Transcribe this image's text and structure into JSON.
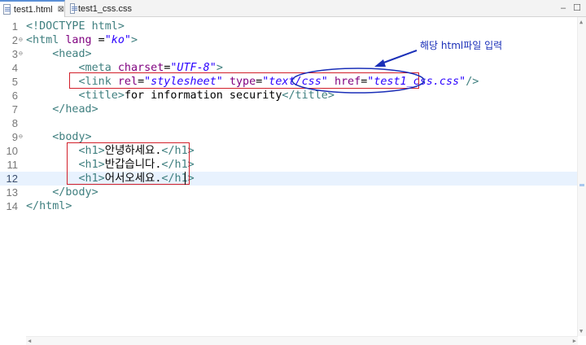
{
  "tabs": [
    {
      "label": "test1.html",
      "active": true
    },
    {
      "label": "test1_css.css",
      "active": false
    }
  ],
  "tab_close_glyph": "⊠",
  "window_controls": [
    "‒",
    "☐"
  ],
  "annotation_text": "해당 html파일 입력",
  "colors": {
    "tag": "#3f7f7f",
    "attr_name": "#7f007f",
    "attr_value": "#2a00ff",
    "annotation": "#1a2fb8",
    "highlight_box": "#d21f2a",
    "current_line": "#e8f2fe"
  },
  "editor": {
    "current_line": 12,
    "lines": [
      {
        "n": "1",
        "fold": "",
        "segments": [
          {
            "c": "t",
            "s": "<!DOCTYPE html>"
          }
        ]
      },
      {
        "n": "2",
        "fold": "⊖",
        "segments": [
          {
            "c": "t",
            "s": "<html"
          },
          {
            "c": "tx",
            "s": " "
          },
          {
            "c": "a",
            "s": "lang"
          },
          {
            "c": "tx",
            "s": " ="
          },
          {
            "c": "v",
            "s": "\"ko\""
          },
          {
            "c": "t",
            "s": ">"
          }
        ]
      },
      {
        "n": "3",
        "fold": "⊖",
        "segments": [
          {
            "c": "tx",
            "s": "    "
          },
          {
            "c": "t",
            "s": "<head>"
          }
        ]
      },
      {
        "n": "4",
        "fold": "",
        "segments": [
          {
            "c": "tx",
            "s": "        "
          },
          {
            "c": "t",
            "s": "<meta"
          },
          {
            "c": "tx",
            "s": " "
          },
          {
            "c": "a",
            "s": "charset"
          },
          {
            "c": "tx",
            "s": "="
          },
          {
            "c": "v",
            "s": "\"UTF-8\""
          },
          {
            "c": "t",
            "s": ">"
          }
        ]
      },
      {
        "n": "5",
        "fold": "",
        "segments": [
          {
            "c": "tx",
            "s": "        "
          },
          {
            "c": "t",
            "s": "<link"
          },
          {
            "c": "tx",
            "s": " "
          },
          {
            "c": "a",
            "s": "rel"
          },
          {
            "c": "tx",
            "s": "="
          },
          {
            "c": "v",
            "s": "\"stylesheet\""
          },
          {
            "c": "tx",
            "s": " "
          },
          {
            "c": "a",
            "s": "type"
          },
          {
            "c": "tx",
            "s": "="
          },
          {
            "c": "v",
            "s": "\"text/css\""
          },
          {
            "c": "tx",
            "s": " "
          },
          {
            "c": "a",
            "s": "href"
          },
          {
            "c": "tx",
            "s": "="
          },
          {
            "c": "v",
            "s": "\"test1_css.css\""
          },
          {
            "c": "t",
            "s": "/>"
          }
        ]
      },
      {
        "n": "6",
        "fold": "",
        "segments": [
          {
            "c": "tx",
            "s": "        "
          },
          {
            "c": "t",
            "s": "<title>"
          },
          {
            "c": "tx",
            "s": "for information security"
          },
          {
            "c": "t",
            "s": "</title>"
          }
        ]
      },
      {
        "n": "7",
        "fold": "",
        "segments": [
          {
            "c": "tx",
            "s": "    "
          },
          {
            "c": "t",
            "s": "</head>"
          }
        ]
      },
      {
        "n": "8",
        "fold": "",
        "segments": []
      },
      {
        "n": "9",
        "fold": "⊖",
        "segments": [
          {
            "c": "tx",
            "s": "    "
          },
          {
            "c": "t",
            "s": "<body>"
          }
        ]
      },
      {
        "n": "10",
        "fold": "",
        "segments": [
          {
            "c": "tx",
            "s": "        "
          },
          {
            "c": "t",
            "s": "<h1>"
          },
          {
            "c": "tx",
            "s": "안녕하세요."
          },
          {
            "c": "t",
            "s": "</h1>"
          }
        ]
      },
      {
        "n": "11",
        "fold": "",
        "segments": [
          {
            "c": "tx",
            "s": "        "
          },
          {
            "c": "t",
            "s": "<h1>"
          },
          {
            "c": "tx",
            "s": "반갑습니다."
          },
          {
            "c": "t",
            "s": "</h1>"
          }
        ]
      },
      {
        "n": "12",
        "fold": "",
        "segments": [
          {
            "c": "tx",
            "s": "        "
          },
          {
            "c": "t",
            "s": "<h1>"
          },
          {
            "c": "tx",
            "s": "어서오세요."
          },
          {
            "c": "t",
            "s": "</h1>"
          }
        ]
      },
      {
        "n": "13",
        "fold": "",
        "segments": [
          {
            "c": "tx",
            "s": "    "
          },
          {
            "c": "t",
            "s": "</body>"
          }
        ]
      },
      {
        "n": "14",
        "fold": "",
        "segments": [
          {
            "c": "t",
            "s": "</html>"
          }
        ]
      }
    ]
  }
}
